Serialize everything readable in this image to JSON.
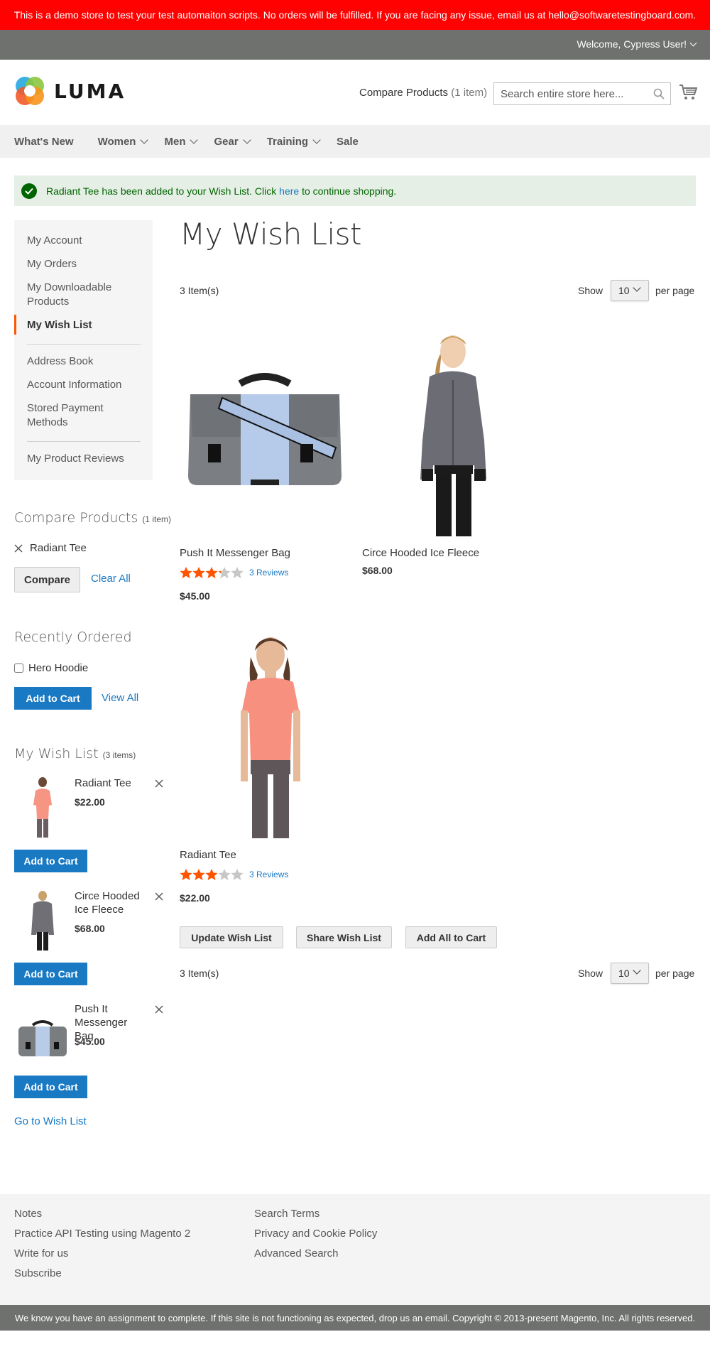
{
  "demo_notice": "This is a demo store to test your test automaiton scripts. No orders will be fulfilled. If you are facing any issue, email us at hello@softwaretestingboard.com.",
  "header": {
    "welcome": "Welcome, Cypress User!",
    "logo_text": "LUMA",
    "compare_label": "Compare Products",
    "compare_count": "(1 item)",
    "search_placeholder": "Search entire store here..."
  },
  "nav": {
    "items": [
      {
        "label": "What's New",
        "has_submenu": false
      },
      {
        "label": "Women",
        "has_submenu": true
      },
      {
        "label": "Men",
        "has_submenu": true
      },
      {
        "label": "Gear",
        "has_submenu": true
      },
      {
        "label": "Training",
        "has_submenu": true
      },
      {
        "label": "Sale",
        "has_submenu": false
      }
    ]
  },
  "message": {
    "before": "Radiant Tee has been added to your Wish List. Click ",
    "link": "here",
    "after": " to continue shopping."
  },
  "account_nav": {
    "items": [
      "My Account",
      "My Orders",
      "My Downloadable Products",
      "My Wish List",
      "Address Book",
      "Account Information",
      "Stored Payment Methods",
      "My Product Reviews"
    ],
    "active": "My Wish List"
  },
  "compare_block": {
    "title": "Compare Products",
    "count": "(1 item)",
    "item": "Radiant Tee",
    "compare_button": "Compare",
    "clear_all": "Clear All"
  },
  "recent_block": {
    "title": "Recently Ordered",
    "item": "Hero Hoodie",
    "add_to_cart": "Add to Cart",
    "view_all": "View All"
  },
  "wishlist_side": {
    "title": "My Wish List",
    "count": "(3 items)",
    "items": [
      {
        "name": "Radiant Tee",
        "price": "$22.00",
        "button": "Add to Cart"
      },
      {
        "name": "Circe Hooded Ice Fleece",
        "price": "$68.00",
        "button": "Add to Cart"
      },
      {
        "name": "Push It Messenger Bag",
        "price": "$45.00",
        "button": "Add to Cart"
      }
    ],
    "go_to": "Go to Wish List"
  },
  "main": {
    "title": "My Wish List",
    "count_text": "3 Item(s)",
    "show_label": "Show",
    "limit_value": "10",
    "per_page": "per page",
    "products": [
      {
        "name": "Push It Messenger Bag",
        "rating_fraction": 0.65,
        "reviews": "3 Reviews",
        "price": "$45.00"
      },
      {
        "name": "Circe Hooded Ice Fleece",
        "price": "$68.00"
      },
      {
        "name": "Radiant Tee",
        "rating_fraction": 0.6,
        "reviews": "3 Reviews",
        "price": "$22.00"
      }
    ],
    "update_button": "Update Wish List",
    "share_button": "Share Wish List",
    "add_all_button": "Add All to Cart"
  },
  "footer": {
    "col1": [
      "Notes",
      "Practice API Testing using Magento 2",
      "Write for us",
      "Subscribe"
    ],
    "col2": [
      "Search Terms",
      "Privacy and Cookie Policy",
      "Advanced Search"
    ],
    "copyright": "We know you have an assignment to complete. If this site is not functioning as expected, drop us an email. Copyright © 2013-present Magento, Inc. All rights reserved."
  },
  "colors": {
    "demo_bar": "#ff0101",
    "panel": "#6e716e",
    "accent_blue": "#1979c3",
    "star_orange": "#ff5501",
    "success_bg": "#e5efe5"
  }
}
